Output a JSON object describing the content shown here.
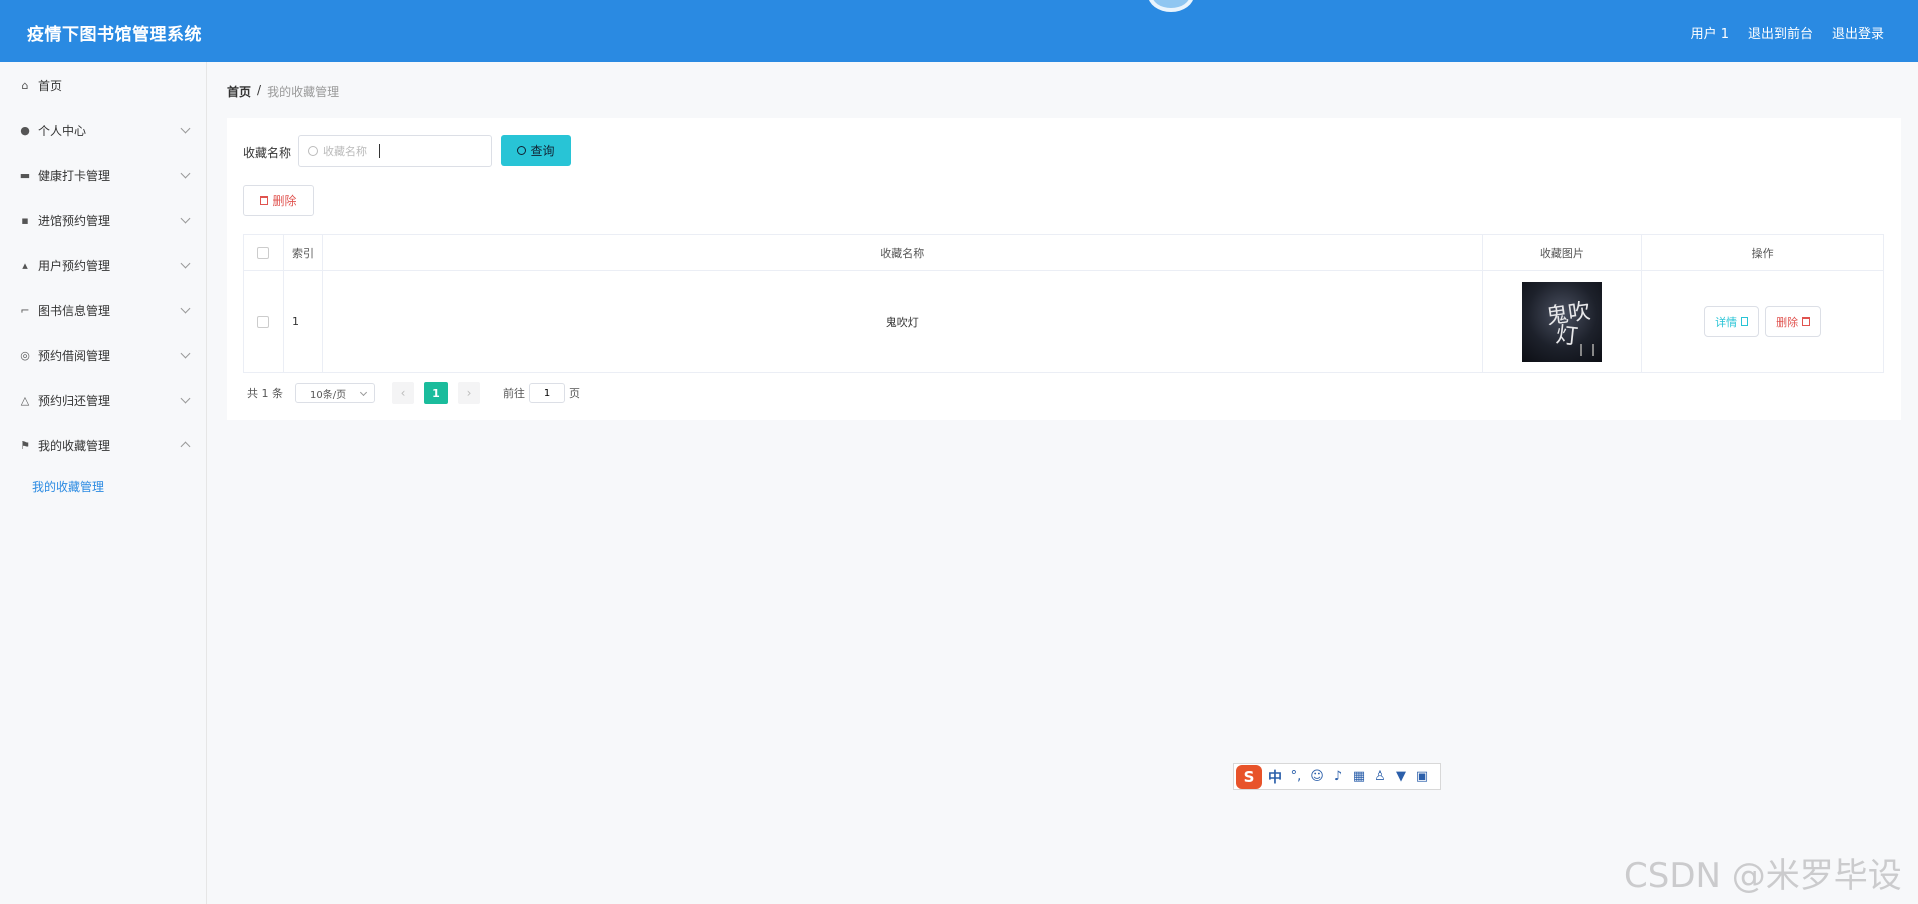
{
  "header": {
    "title": "疫情下图书馆管理系统",
    "links": [
      "用户 1",
      "退出到前台",
      "退出登录"
    ]
  },
  "sidebar": {
    "items": [
      {
        "label": "首页",
        "icon": "home-icon",
        "expandable": false
      },
      {
        "label": "个人中心",
        "icon": "user-icon",
        "expandable": true
      },
      {
        "label": "健康打卡管理",
        "icon": "ticket-icon",
        "expandable": true
      },
      {
        "label": "进馆预约管理",
        "icon": "comment-icon",
        "expandable": true
      },
      {
        "label": "用户预约管理",
        "icon": "thumbs-up-icon",
        "expandable": true
      },
      {
        "label": "图书信息管理",
        "icon": "crop-icon",
        "expandable": true
      },
      {
        "label": "预约借阅管理",
        "icon": "compass-icon",
        "expandable": true
      },
      {
        "label": "预约归还管理",
        "icon": "bell-off-icon",
        "expandable": true
      },
      {
        "label": "我的收藏管理",
        "icon": "flag-icon",
        "expandable": true,
        "expanded": true
      }
    ],
    "submenu": {
      "label": "我的收藏管理"
    }
  },
  "breadcrumb": {
    "home": "首页",
    "separator": "/",
    "current": "我的收藏管理"
  },
  "search": {
    "label": "收藏名称",
    "placeholder": "收藏名称",
    "value": "",
    "button_label": "查询"
  },
  "toolbar": {
    "delete_label": "删除"
  },
  "table": {
    "columns": [
      "索引",
      "收藏名称",
      "收藏图片",
      "操作"
    ],
    "rows": [
      {
        "index": "1",
        "name": "鬼吹灯",
        "image_text_1": "鬼吹",
        "image_text_2": "灯",
        "detail_label": "详情",
        "delete_label": "删除"
      }
    ]
  },
  "pagination": {
    "total": "共 1 条",
    "page_size": "10条/页",
    "prev": "‹",
    "next": "›",
    "current_page": "1",
    "goto_label": "前往",
    "goto_value": "1",
    "page_suffix": "页"
  },
  "ime": {
    "logo": "S",
    "mode": "中",
    "punct": "°,"
  },
  "watermark": "CSDN @米罗毕设",
  "colors": {
    "header": "#2a8ae2",
    "accent": "#28c4d6",
    "active_page": "#1abc9c",
    "danger": "#e0534f"
  }
}
